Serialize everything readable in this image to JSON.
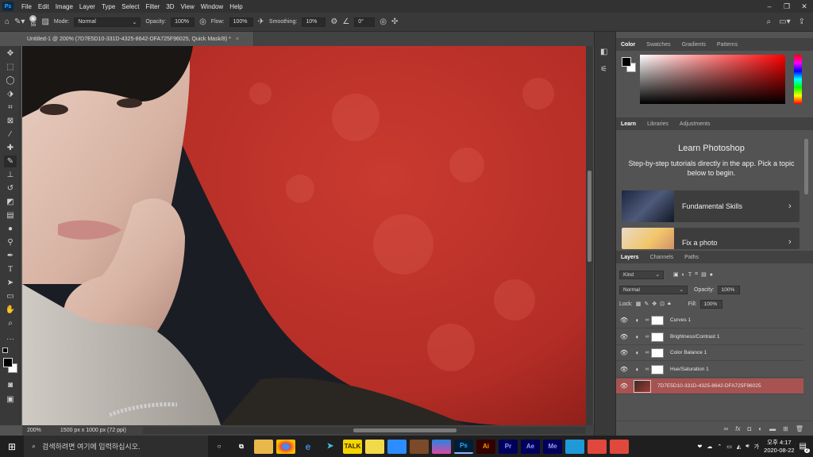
{
  "app": {
    "logo": "Ps",
    "menu": [
      "File",
      "Edit",
      "Image",
      "Layer",
      "Type",
      "Select",
      "Filter",
      "3D",
      "View",
      "Window",
      "Help"
    ],
    "win_controls": [
      "–",
      "❐",
      "✕"
    ]
  },
  "options": {
    "brush_size": "55",
    "mode_label": "Mode:",
    "mode_value": "Normal",
    "opacity_label": "Opacity:",
    "opacity_value": "100%",
    "flow_label": "Flow:",
    "flow_value": "100%",
    "smoothing_label": "Smoothing:",
    "smoothing_value": "10%",
    "angle_value": "0°"
  },
  "document": {
    "tab_title": "Untitled-1 @ 200% (7D7E5D10-331D-4325-8642-DFA725F96025, Quick Mask/8) *",
    "close": "×",
    "zoom": "200%",
    "doc_info": "1500 px x 1000 px (72 ppi)"
  },
  "panels": {
    "color_tabs": [
      "Color",
      "Swatches",
      "Gradients",
      "Patterns"
    ],
    "learn_tabs": [
      "Learn",
      "Libraries",
      "Adjustments"
    ],
    "learn_title": "Learn Photoshop",
    "learn_desc": "Step-by-step tutorials directly in the app. Pick a topic below to begin.",
    "learn_cards": [
      "Fundamental Skills",
      "Fix a photo"
    ],
    "layers_tabs": [
      "Layers",
      "Channels",
      "Paths"
    ],
    "kind_value": "Kind",
    "blend_value": "Normal",
    "opacity_label": "Opacity:",
    "opacity_value": "100%",
    "lock_label": "Lock:",
    "fill_label": "Fill:",
    "fill_value": "100%",
    "layers": [
      {
        "name": "Curves 1",
        "type": "adjustment"
      },
      {
        "name": "Brightness/Contrast 1",
        "type": "adjustment"
      },
      {
        "name": "Color Balance 1",
        "type": "adjustment"
      },
      {
        "name": "Hue/Saturation 1",
        "type": "adjustment"
      },
      {
        "name": "7D7E5D10-331D-4325-8642-DFA725F96025",
        "type": "pixel",
        "selected": true
      }
    ]
  },
  "taskbar": {
    "search_placeholder": "검색하려면 여기에 입력하십시오.",
    "apps": [
      "Ai",
      "Pr",
      "Ae",
      "Me"
    ],
    "ps_label": "Ps",
    "time": "오후 4:17",
    "date": "2020-08-22",
    "notif_count": "2"
  },
  "colors": {
    "accent": "#31a8ff",
    "selected_layer": "#a75352",
    "moon": "#c0322a"
  }
}
